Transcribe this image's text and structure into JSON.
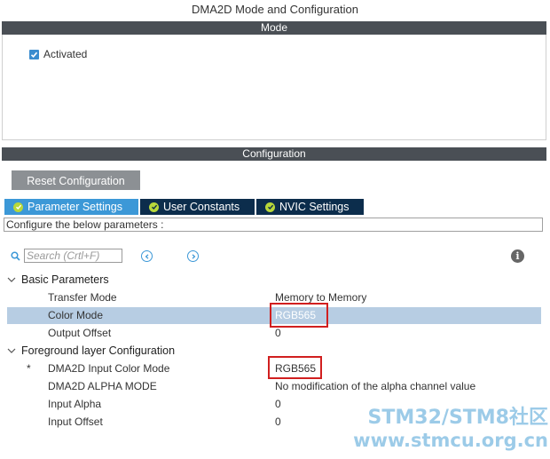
{
  "window": {
    "title": "DMA2D Mode and Configuration"
  },
  "mode_section": {
    "header": "Mode",
    "activated": {
      "label": "Activated",
      "checked": true
    }
  },
  "config_section": {
    "header": "Configuration",
    "reset_button": "Reset Configuration",
    "tabs": [
      {
        "label": "Parameter Settings",
        "active": true
      },
      {
        "label": "User Constants",
        "active": false
      },
      {
        "label": "NVIC Settings",
        "active": false
      }
    ],
    "info_text": "Configure the below parameters :",
    "search": {
      "placeholder": "Search (Crtl+F)",
      "value": ""
    }
  },
  "parameters": {
    "basic": {
      "label": "Basic Parameters",
      "rows": [
        {
          "name": "Transfer Mode",
          "value": "Memory to Memory"
        },
        {
          "name": "Color Mode",
          "value": "RGB565"
        },
        {
          "name": "Output Offset",
          "value": "0"
        }
      ]
    },
    "foreground": {
      "label": "Foreground layer Configuration",
      "rows": [
        {
          "name": "DMA2D Input Color Mode",
          "value": "RGB565",
          "required_mark": "*"
        },
        {
          "name": "DMA2D ALPHA MODE",
          "value": "No modification of the alpha channel value"
        },
        {
          "name": "Input Alpha",
          "value": "0"
        },
        {
          "name": "Input Offset",
          "value": "0"
        }
      ]
    }
  },
  "watermark": {
    "line1": "STM32/STM8社区",
    "line2": "www.stmcu.org.cn"
  },
  "colors": {
    "section_header": "#4a4f55",
    "tab_active": "#3c98d7",
    "tab_inactive": "#0c2d4c",
    "selected_row": "#b7cde3",
    "highlight_box": "#d11f1f",
    "tick_icon": "#b8d83a"
  }
}
